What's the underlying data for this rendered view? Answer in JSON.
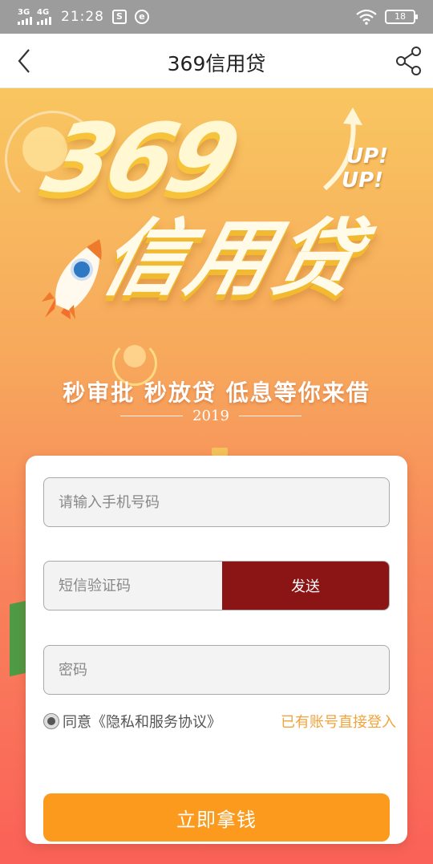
{
  "status_bar": {
    "signal1_label": "3G",
    "signal2_label": "4G",
    "time": "21:28",
    "notif1": "S",
    "notif2": "e",
    "battery": "18"
  },
  "nav": {
    "title": "369信用贷",
    "back_icon": "chevron-left-icon",
    "share_icon": "share-icon"
  },
  "banner": {
    "logo_number": "369",
    "logo_name": "信用贷",
    "up_line1": "UP!",
    "up_line2": "UP!",
    "slogan": "秒审批 秒放贷 低息等你来借",
    "year": "2019",
    "colors": {
      "top": "#f8c660",
      "bottom": "#fa6158"
    }
  },
  "form": {
    "phone_placeholder": "请输入手机号码",
    "code_placeholder": "短信验证码",
    "send_label": "发送",
    "password_placeholder": "密码",
    "agree_text": "同意《隐私和服务协议》",
    "login_link": "已有账号直接登入",
    "submit_label": "立即拿钱",
    "colors": {
      "send": "#8b1414",
      "submit": "#fc9a1d",
      "link": "#f2a43c"
    }
  }
}
